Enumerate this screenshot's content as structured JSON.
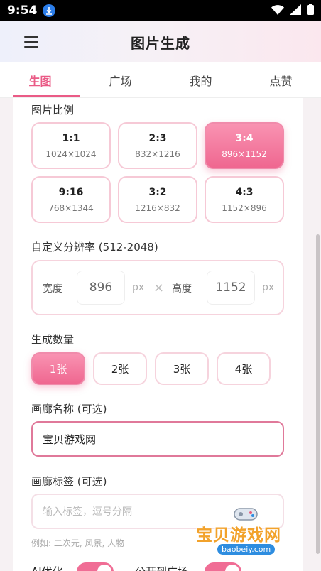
{
  "status_bar": {
    "time": "9:54"
  },
  "header": {
    "title": "图片生成"
  },
  "tabs": [
    {
      "label": "生图",
      "active": true
    },
    {
      "label": "广场",
      "active": false
    },
    {
      "label": "我的",
      "active": false
    },
    {
      "label": "点赞",
      "active": false
    }
  ],
  "ratio": {
    "label": "图片比例",
    "options": [
      {
        "label": "1:1",
        "size": "1024×1024",
        "selected": false
      },
      {
        "label": "2:3",
        "size": "832×1216",
        "selected": false
      },
      {
        "label": "3:4",
        "size": "896×1152",
        "selected": true
      },
      {
        "label": "9:16",
        "size": "768×1344",
        "selected": false
      },
      {
        "label": "3:2",
        "size": "1216×832",
        "selected": false
      },
      {
        "label": "4:3",
        "size": "1152×896",
        "selected": false
      }
    ]
  },
  "resolution": {
    "label": "自定义分辨率 (512-2048)",
    "width_label": "宽度",
    "width_value": "896",
    "height_label": "高度",
    "height_value": "1152",
    "unit": "px",
    "times": "×"
  },
  "count": {
    "label": "生成数量",
    "options": [
      {
        "label": "1张",
        "selected": true
      },
      {
        "label": "2张",
        "selected": false
      },
      {
        "label": "3张",
        "selected": false
      },
      {
        "label": "4张",
        "selected": false
      }
    ]
  },
  "gallery_name": {
    "label": "画廊名称 (可选)",
    "value": "宝贝游戏网"
  },
  "gallery_tags": {
    "label": "画廊标签 (可选)",
    "placeholder": "输入标签，逗号分隔",
    "hint": "例如: 二次元, 风景, 人物"
  },
  "toggles": {
    "ai_optimize": {
      "label": "AI优化",
      "on": true
    },
    "publish_square": {
      "label": "公开到广场",
      "on": true
    }
  },
  "watermark": {
    "text": "宝贝游戏网",
    "url": "baobeiy.com"
  },
  "colors": {
    "accent": "#ea5b86",
    "accent_light": "#f6c9d6"
  }
}
